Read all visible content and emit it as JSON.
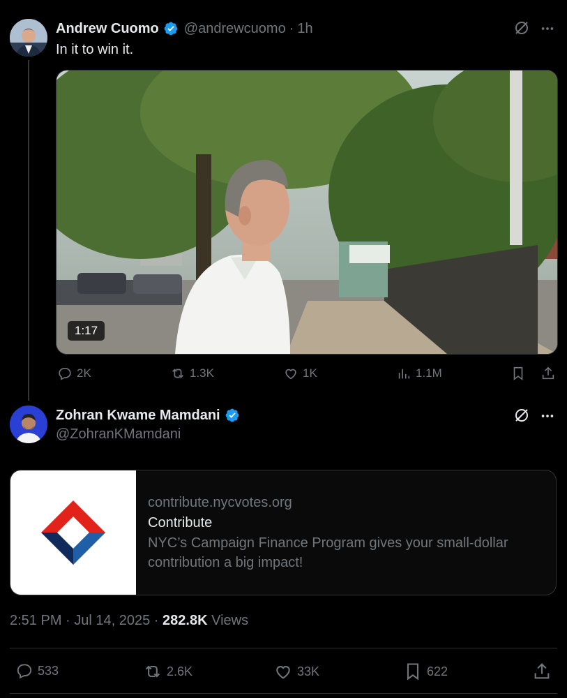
{
  "quoted_post": {
    "author_name": "Andrew Cuomo",
    "handle": "@andrewcuomo",
    "separator": "·",
    "time": "1h",
    "text": "In it to win it.",
    "video_duration": "1:17",
    "actions": {
      "replies": "2K",
      "reposts": "1.3K",
      "likes": "1K",
      "views": "1.1M"
    }
  },
  "main_post": {
    "author_name": "Zohran Kwame Mamdani",
    "handle": "@ZohranKMamdani",
    "link_card": {
      "domain": "contribute.nycvotes.org",
      "title": "Contribute",
      "description": "NYC’s Campaign Finance Program gives your small-dollar contribution a big impact!"
    },
    "timestamp": "2:51 PM · Jul 14, 2025",
    "separator": "·",
    "view_count": "282.8K",
    "views_label": "Views",
    "actions": {
      "replies": "533",
      "reposts": "2.6K",
      "likes": "33K",
      "bookmarks": "622"
    }
  },
  "colors": {
    "background": "#000000",
    "text": "#e7e9ea",
    "muted": "#71767b",
    "verified": "#1d9bf0",
    "divider": "#2f3336",
    "logo_red": "#e2231a",
    "logo_navy": "#0f2a5b",
    "logo_blue": "#1f5fa8"
  }
}
